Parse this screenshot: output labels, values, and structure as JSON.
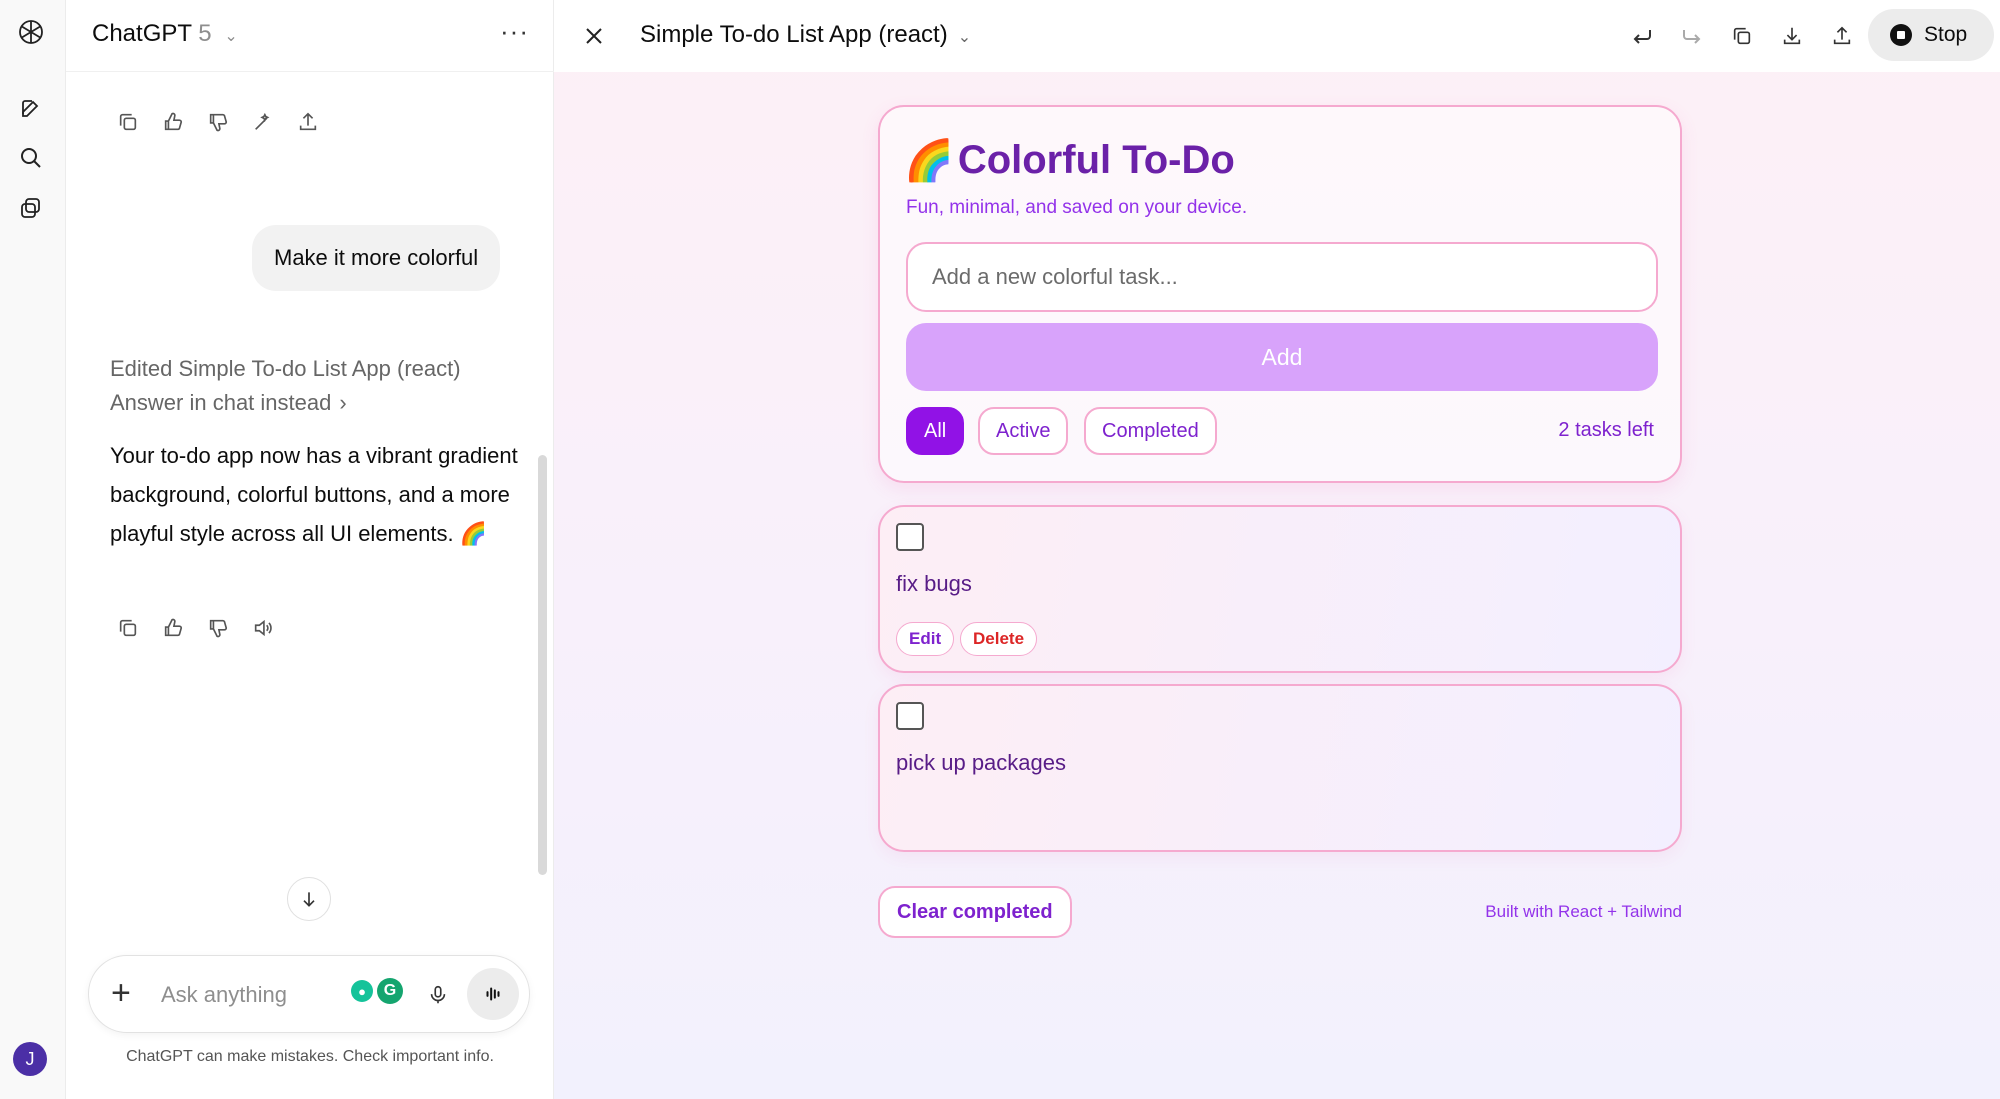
{
  "chat": {
    "title": "ChatGPT",
    "version": "5",
    "user_message": "Make it more colorful",
    "edited_label": "Edited Simple To-do List App (react)",
    "answer_in_chat": "Answer in chat instead",
    "reply_text": "Your to-do app now has a vibrant gradient background, colorful buttons, and a more playful style across all UI elements. 🌈",
    "composer_placeholder": "Ask anything",
    "disclaimer": "ChatGPT can make mistakes. Check important info.",
    "avatar_initial": "J"
  },
  "canvas": {
    "title": "Simple To-do List App (react)",
    "stop_label": "Stop"
  },
  "app": {
    "emoji": "🌈",
    "title": "Colorful To-Do",
    "subtitle": "Fun, minimal, and saved on your device.",
    "input_placeholder": "Add a new colorful task...",
    "add_label": "Add",
    "filters": [
      "All",
      "Active",
      "Completed"
    ],
    "tasks_left": "2 tasks left",
    "tasks": [
      {
        "text": "fix bugs",
        "done": false,
        "edit_label": "Edit",
        "delete_label": "Delete"
      },
      {
        "text": "pick up packages",
        "done": false
      }
    ],
    "clear_label": "Clear completed",
    "footer": "Built with React + Tailwind"
  },
  "colors": {
    "accent_purple": "#9112e6",
    "title_purple": "#6b21a8",
    "pink_border": "#f5a9cf",
    "add_button": "#d8a3fb",
    "delete_red": "#dc2626"
  }
}
